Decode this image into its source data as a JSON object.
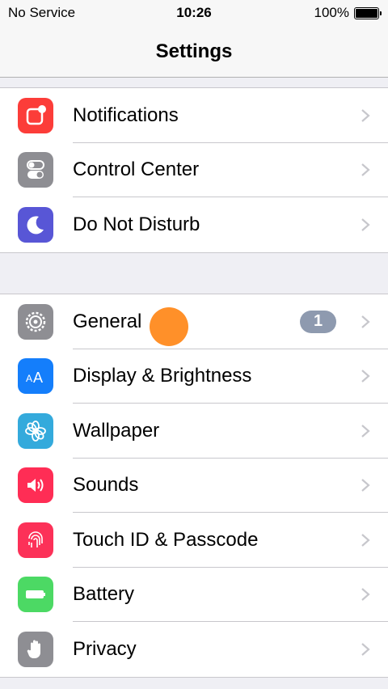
{
  "status_bar": {
    "carrier": "No Service",
    "time": "10:26",
    "battery": "100%"
  },
  "nav": {
    "title": "Settings"
  },
  "groups": [
    {
      "items": [
        {
          "label": "Notifications",
          "icon": "notifications-icon",
          "color": "#fc3d39"
        },
        {
          "label": "Control Center",
          "icon": "control-center-icon",
          "color": "#8e8e93"
        },
        {
          "label": "Do Not Disturb",
          "icon": "moon-icon",
          "color": "#5856d6"
        }
      ]
    },
    {
      "items": [
        {
          "label": "General",
          "icon": "gear-icon",
          "color": "#8e8e93",
          "badge": "1"
        },
        {
          "label": "Display & Brightness",
          "icon": "display-brightness-icon",
          "color": "#147efb"
        },
        {
          "label": "Wallpaper",
          "icon": "wallpaper-icon",
          "color": "#34aadc"
        },
        {
          "label": "Sounds",
          "icon": "speaker-icon",
          "color": "#ff2d55"
        },
        {
          "label": "Touch ID & Passcode",
          "icon": "fingerprint-icon",
          "color": "#fc3158"
        },
        {
          "label": "Battery",
          "icon": "battery-icon",
          "color": "#4cd964"
        },
        {
          "label": "Privacy",
          "icon": "hand-icon",
          "color": "#8e8e93"
        }
      ]
    }
  ],
  "colors": {
    "chevron": "#c7c7cc",
    "badge": "#8e9aaf",
    "touch_indicator": "#ff8a1e"
  }
}
